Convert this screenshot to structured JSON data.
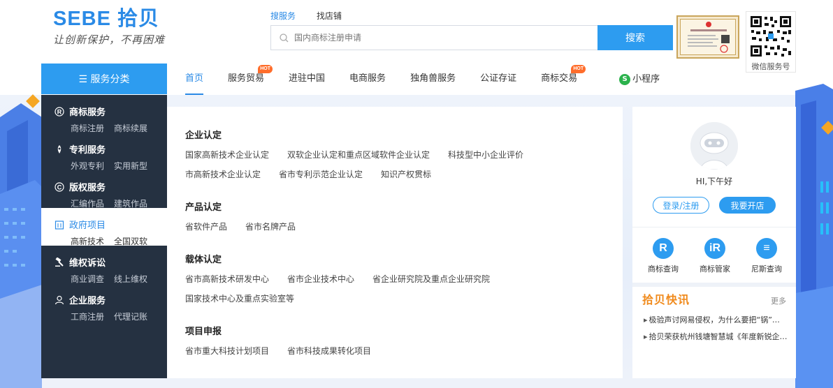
{
  "logo": {
    "brand": "SEBE 拾贝",
    "slogan": "让创新保护，不再困难"
  },
  "search": {
    "tabs": [
      {
        "label": "搜服务",
        "active": true
      },
      {
        "label": "找店铺",
        "active": false
      }
    ],
    "placeholder": "国内商标注册申请",
    "button_label": "搜索"
  },
  "qr": {
    "label": "微信服务号"
  },
  "nav": {
    "category_button": "☰ 服务分类",
    "items": [
      {
        "label": "首页",
        "active": true,
        "hot": false
      },
      {
        "label": "服务贸易",
        "active": false,
        "hot": true
      },
      {
        "label": "进驻中国",
        "active": false,
        "hot": false
      },
      {
        "label": "电商服务",
        "active": false,
        "hot": false
      },
      {
        "label": "独角兽服务",
        "active": false,
        "hot": false
      },
      {
        "label": "公证存证",
        "active": false,
        "hot": false
      },
      {
        "label": "商标交易",
        "active": false,
        "hot": true
      }
    ],
    "hot_label": "HOT",
    "mini_program": "小程序"
  },
  "sidebar": {
    "groups": [
      {
        "title": "商标服务",
        "icon": "registered-icon",
        "links": [
          "商标注册",
          "商标续展"
        ],
        "active": false
      },
      {
        "title": "专利服务",
        "icon": "patent-icon",
        "links": [
          "外观专利",
          "实用新型"
        ],
        "active": false
      },
      {
        "title": "版权服务",
        "icon": "copyright-icon",
        "links": [
          "汇编作品",
          "建筑作品"
        ],
        "active": false
      },
      {
        "title": "政府项目",
        "icon": "building-icon",
        "links": [
          "高新技术",
          "全国双软"
        ],
        "active": true
      },
      {
        "title": "维权诉讼",
        "icon": "gavel-icon",
        "links": [
          "商业调查",
          "线上维权"
        ],
        "active": false
      },
      {
        "title": "企业服务",
        "icon": "person-icon",
        "links": [
          "工商注册",
          "代理记账"
        ],
        "active": false
      }
    ]
  },
  "content": {
    "sections": [
      {
        "title": "企业认定",
        "links": [
          "国家高新技术企业认定",
          "双软企业认定和重点区域软件企业认定",
          "科技型中小企业评价",
          "市高新技术企业认定",
          "省市专利示范企业认定",
          "知识产权贯标"
        ]
      },
      {
        "title": "产品认定",
        "links": [
          "省软件产品",
          "省市名牌产品"
        ]
      },
      {
        "title": "载体认定",
        "links": [
          "省市高新技术研发中心",
          "省市企业技术中心",
          "省企业研究院及重点企业研究院",
          "国家技术中心及重点实验室等"
        ]
      },
      {
        "title": "项目申报",
        "links": [
          "省市重大科技计划项目",
          "省市科技成果转化项目"
        ]
      }
    ]
  },
  "user_panel": {
    "greeting": "HI,下午好",
    "login_button": "登录/注册",
    "open_shop_button": "我要开店",
    "tools": [
      {
        "label": "商标查询",
        "glyph": "R"
      },
      {
        "label": "商标管家",
        "glyph": "iR"
      },
      {
        "label": "尼斯查询",
        "glyph": "≡"
      }
    ],
    "news_title": "拾贝快讯",
    "news_more": "更多",
    "news": [
      "极验声讨网易侵权，为什么要把“锅”…",
      "拾贝荣获杭州钱塘智慧城《年度新锐企…"
    ]
  },
  "colors": {
    "accent": "#2d9cf0",
    "sidebar_bg": "#253141",
    "news_title": "#f08a1c",
    "hot": "#ff6d2b"
  }
}
